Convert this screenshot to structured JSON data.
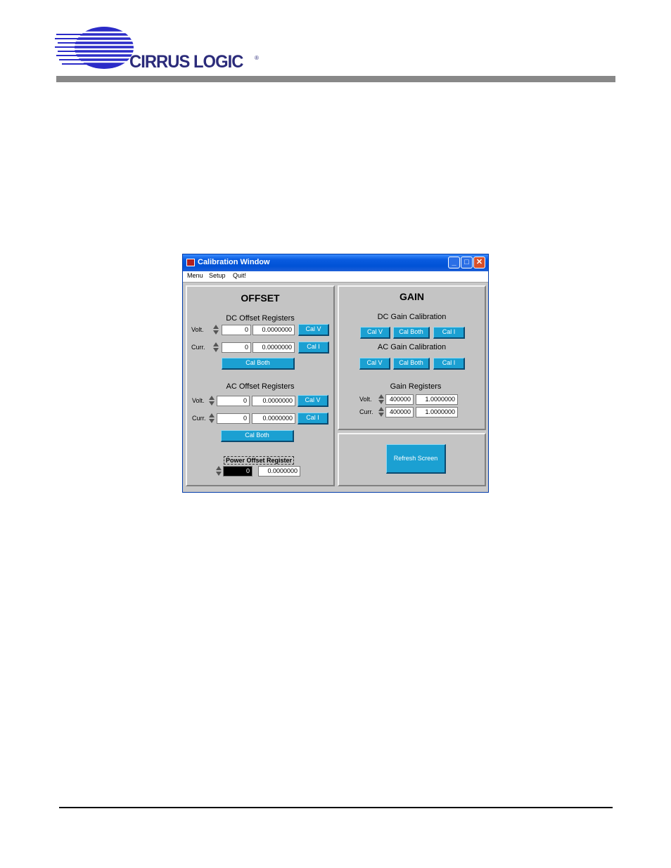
{
  "header": {
    "logo_text": "CIRRUS LOGIC",
    "logo_mark": "®",
    "brand_color": "#2b2bc8"
  },
  "window": {
    "title": "Calibration Window",
    "menu": [
      "Menu",
      "Setup",
      "Quit!"
    ],
    "title_bar_color": "#0a5ce0"
  },
  "offset": {
    "title": "OFFSET",
    "dc": {
      "title": "DC Offset Registers",
      "volt_label": "Volt.",
      "volt_reg": "0",
      "volt_val": "0.0000000",
      "volt_btn": "Cal V",
      "curr_label": "Curr.",
      "curr_reg": "0",
      "curr_val": "0.0000000",
      "curr_btn": "Cal I",
      "both_btn": "Cal Both"
    },
    "ac": {
      "title": "AC Offset Registers",
      "volt_label": "Volt.",
      "volt_reg": "0",
      "volt_val": "0.0000000",
      "volt_btn": "Cal V",
      "curr_label": "Curr.",
      "curr_reg": "0",
      "curr_val": "0.0000000",
      "curr_btn": "Cal I",
      "both_btn": "Cal Both"
    },
    "power": {
      "title": "Power Offset Register",
      "reg": "0",
      "val": "0.0000000"
    }
  },
  "gain": {
    "title": "GAIN",
    "dc_title": "DC Gain Calibration",
    "dc_buttons": [
      "Cal V",
      "Cal Both",
      "Cal I"
    ],
    "ac_title": "AC Gain Calibration",
    "ac_buttons": [
      "Cal V",
      "Cal Both",
      "Cal I"
    ],
    "reg_title": "Gain Registers",
    "volt_label": "Volt.",
    "volt_reg": "400000",
    "volt_val": "1.0000000",
    "curr_label": "Curr.",
    "curr_reg": "400000",
    "curr_val": "1.0000000"
  },
  "refresh_btn": "Refresh Screen",
  "button_color": "#1ba0d2"
}
